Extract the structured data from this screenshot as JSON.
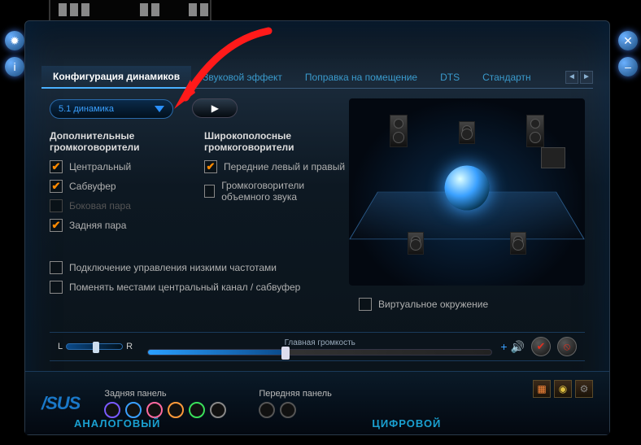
{
  "tabs": {
    "active": "Конфигурация динамиков",
    "t1": "Звуковой эффект",
    "t2": "Поправка на помещение",
    "t3": "DTS",
    "t4": "Стандартн"
  },
  "dropdown": {
    "value": "5.1 динамика"
  },
  "col1": {
    "head": "Дополнительные громкоговорители",
    "c1": "Центральный",
    "c2": "Сабвуфер",
    "c3": "Боковая пара",
    "c4": "Задняя пара"
  },
  "col2": {
    "head": "Широкополосные громкоговорители",
    "c1": "Передние левый и правый",
    "c2": "Громкоговорители объемного звука"
  },
  "wide": {
    "bass": "Подключение управления низкими частотами",
    "swap": "Поменять местами центральный канал / сабвуфер"
  },
  "virtual": "Виртуальное окружение",
  "volume": {
    "l": "L",
    "r": "R",
    "main": "Главная громкость",
    "plus": "+"
  },
  "bottom": {
    "logo": "/SUS",
    "rear": "Задняя панель",
    "front": "Передняя панель",
    "analog": "АНАЛОГОВЫЙ",
    "digital": "ЦИФРОВОЙ"
  },
  "nav": {
    "prev": "◄",
    "next": "►"
  }
}
